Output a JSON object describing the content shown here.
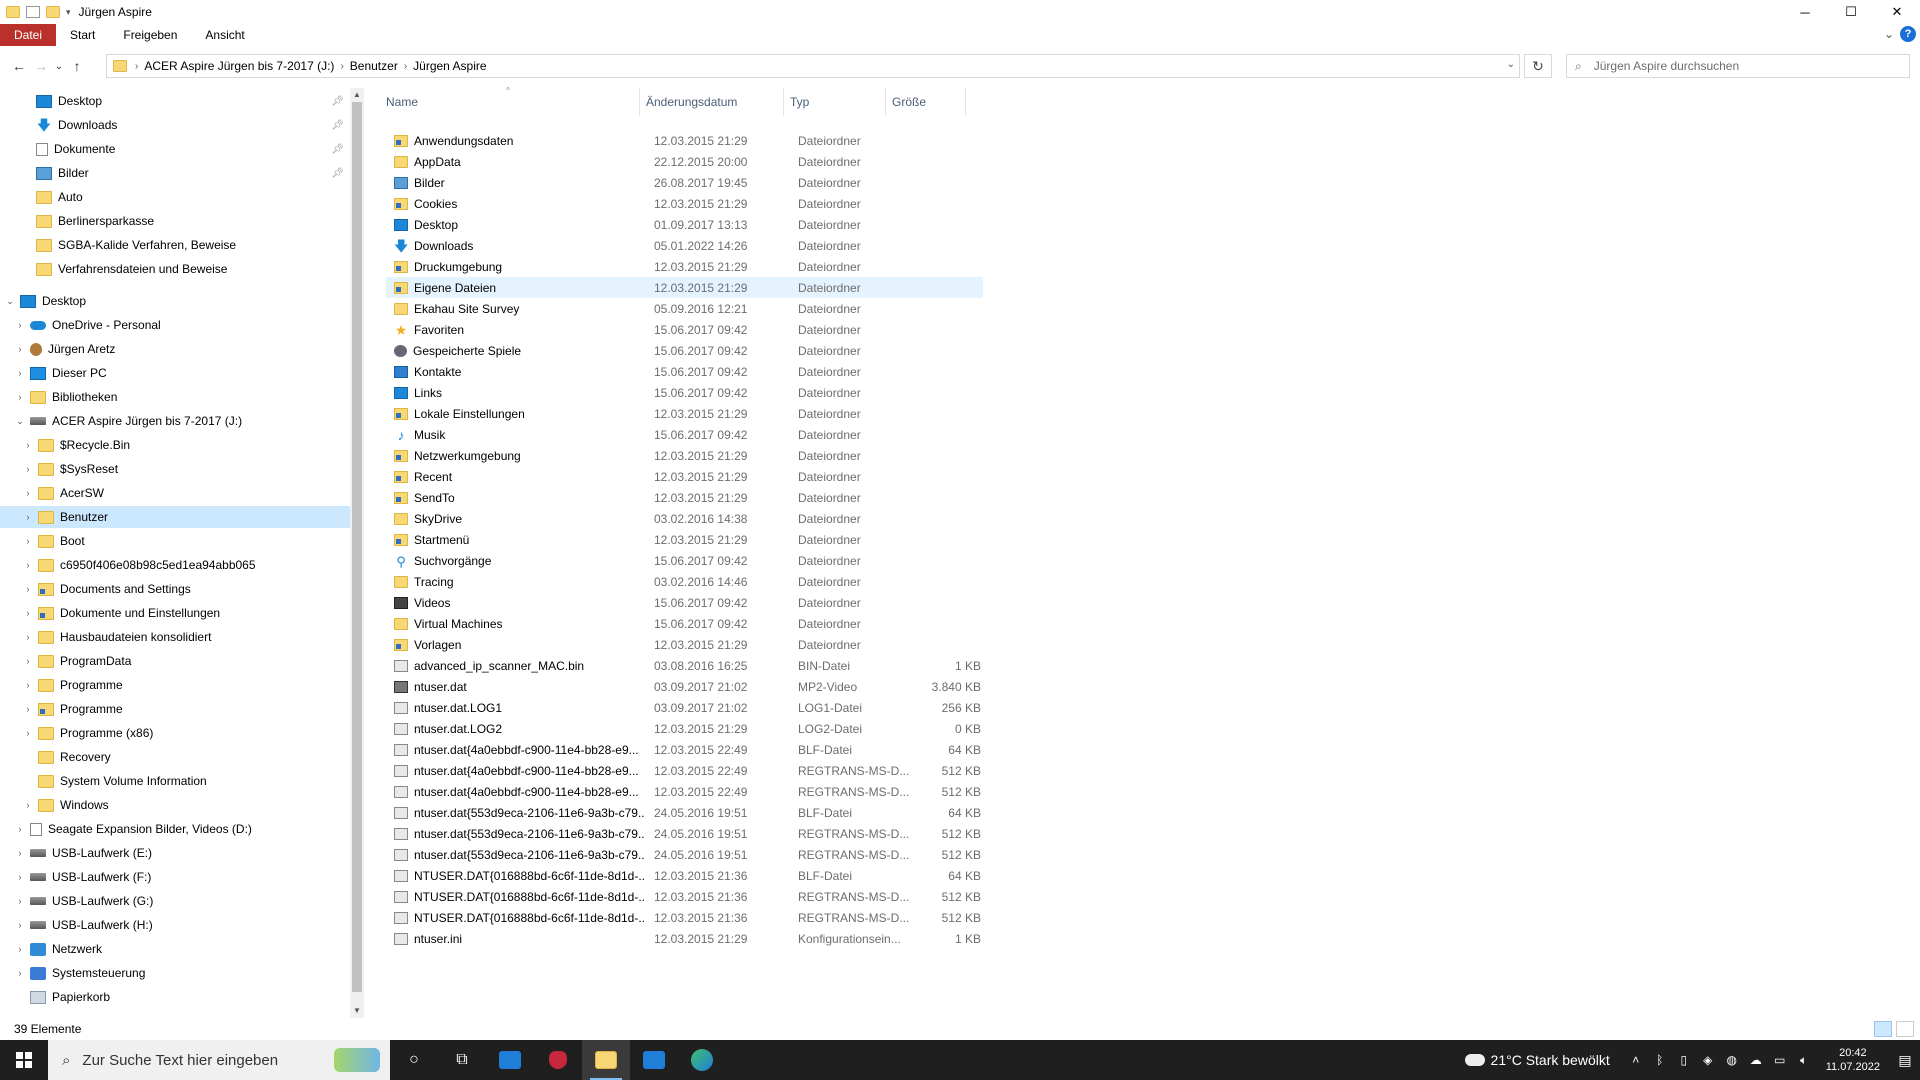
{
  "window": {
    "title": "Jürgen Aspire",
    "controls": {
      "minimize": "─",
      "maximize": "☐",
      "close": "✕"
    }
  },
  "ribbon": {
    "tabs": [
      "Datei",
      "Start",
      "Freigeben",
      "Ansicht"
    ],
    "expand": "⌄",
    "help": "?"
  },
  "nav": {
    "back": "←",
    "forward": "→",
    "recent": "⌄",
    "up": "↑",
    "breadcrumb": [
      "ACER Aspire Jürgen bis 7-2017 (J:)",
      "Benutzer",
      "Jürgen Aspire"
    ],
    "refresh": "↻",
    "search_placeholder": "Jürgen Aspire durchsuchen"
  },
  "tree": {
    "quick_access": [
      {
        "label": "Desktop",
        "icon": "desktop-icon",
        "pinned": true
      },
      {
        "label": "Downloads",
        "icon": "download-icon",
        "pinned": true
      },
      {
        "label": "Dokumente",
        "icon": "document-icon",
        "pinned": true
      },
      {
        "label": "Bilder",
        "icon": "pictures-icon",
        "pinned": true
      },
      {
        "label": "Auto",
        "icon": "folder-icon",
        "pinned": false
      },
      {
        "label": "Berlinersparkasse",
        "icon": "folder-icon",
        "pinned": false
      },
      {
        "label": "SGBA-Kalide Verfahren, Beweise",
        "icon": "folder-icon",
        "pinned": false
      },
      {
        "label": "Verfahrensdateien und Beweise",
        "icon": "folder-icon",
        "pinned": false
      }
    ],
    "desktop_root": "Desktop",
    "desktop_children": [
      {
        "label": "OneDrive - Personal",
        "icon": "onedrive-icon"
      },
      {
        "label": "Jürgen Aretz",
        "icon": "user-icon"
      },
      {
        "label": "Dieser PC",
        "icon": "pc-icon"
      },
      {
        "label": "Bibliotheken",
        "icon": "library-icon"
      },
      {
        "label": "ACER Aspire Jürgen bis 7-2017 (J:)",
        "icon": "drive-icon",
        "expanded": true
      }
    ],
    "drive_children": [
      {
        "label": "$Recycle.Bin",
        "icon": "folder-icon"
      },
      {
        "label": "$SysReset",
        "icon": "folder-icon"
      },
      {
        "label": "AcerSW",
        "icon": "folder-icon"
      },
      {
        "label": "Benutzer",
        "icon": "folder-icon",
        "selected": true
      },
      {
        "label": "Boot",
        "icon": "folder-icon"
      },
      {
        "label": "c6950f406e08b98c5ed1ea94abb065",
        "icon": "folder-icon"
      },
      {
        "label": "Documents and Settings",
        "icon": "link-folder-icon"
      },
      {
        "label": "Dokumente und Einstellungen",
        "icon": "link-folder-icon"
      },
      {
        "label": "Hausbaudateien konsolidiert",
        "icon": "folder-icon"
      },
      {
        "label": "ProgramData",
        "icon": "folder-icon"
      },
      {
        "label": "Programme",
        "icon": "folder-icon"
      },
      {
        "label": "Programme",
        "icon": "link-folder-icon"
      },
      {
        "label": "Programme (x86)",
        "icon": "folder-icon"
      },
      {
        "label": "Recovery",
        "icon": "folder-icon",
        "nochev": true
      },
      {
        "label": "System Volume Information",
        "icon": "folder-icon",
        "nochev": true
      },
      {
        "label": "Windows",
        "icon": "folder-icon"
      }
    ],
    "other_roots": [
      {
        "label": "Seagate Expansion Bilder, Videos (D:)",
        "icon": "doc-drive-icon"
      },
      {
        "label": "USB-Laufwerk (E:)",
        "icon": "drive-icon"
      },
      {
        "label": "USB-Laufwerk (F:)",
        "icon": "drive-icon"
      },
      {
        "label": "USB-Laufwerk (G:)",
        "icon": "drive-icon"
      },
      {
        "label": "USB-Laufwerk (H:)",
        "icon": "drive-icon"
      },
      {
        "label": "Netzwerk",
        "icon": "network-icon"
      },
      {
        "label": "Systemsteuerung",
        "icon": "control-panel-icon"
      },
      {
        "label": "Papierkorb",
        "icon": "recycle-bin-icon",
        "nochev": true
      }
    ]
  },
  "columns": [
    "Name",
    "Änderungsdatum",
    "Typ",
    "Größe"
  ],
  "files": [
    {
      "name": "Anwendungsdaten",
      "date": "12.03.2015 21:29",
      "type": "Dateiordner",
      "size": "",
      "icon": "link-folder-icon"
    },
    {
      "name": "AppData",
      "date": "22.12.2015 20:00",
      "type": "Dateiordner",
      "size": "",
      "icon": "folder-icon"
    },
    {
      "name": "Bilder",
      "date": "26.08.2017 19:45",
      "type": "Dateiordner",
      "size": "",
      "icon": "pictures-icon"
    },
    {
      "name": "Cookies",
      "date": "12.03.2015 21:29",
      "type": "Dateiordner",
      "size": "",
      "icon": "link-folder-icon"
    },
    {
      "name": "Desktop",
      "date": "01.09.2017 13:13",
      "type": "Dateiordner",
      "size": "",
      "icon": "desktop-icon"
    },
    {
      "name": "Downloads",
      "date": "05.01.2022 14:26",
      "type": "Dateiordner",
      "size": "",
      "icon": "download-icon"
    },
    {
      "name": "Druckumgebung",
      "date": "12.03.2015 21:29",
      "type": "Dateiordner",
      "size": "",
      "icon": "link-folder-icon"
    },
    {
      "name": "Eigene Dateien",
      "date": "12.03.2015 21:29",
      "type": "Dateiordner",
      "size": "",
      "icon": "link-folder-icon",
      "selected": true
    },
    {
      "name": "Ekahau Site Survey",
      "date": "05.09.2016 12:21",
      "type": "Dateiordner",
      "size": "",
      "icon": "folder-icon"
    },
    {
      "name": "Favoriten",
      "date": "15.06.2017 09:42",
      "type": "Dateiordner",
      "size": "",
      "icon": "star-icon"
    },
    {
      "name": "Gespeicherte Spiele",
      "date": "15.06.2017 09:42",
      "type": "Dateiordner",
      "size": "",
      "icon": "games-icon"
    },
    {
      "name": "Kontakte",
      "date": "15.06.2017 09:42",
      "type": "Dateiordner",
      "size": "",
      "icon": "contacts-icon"
    },
    {
      "name": "Links",
      "date": "15.06.2017 09:42",
      "type": "Dateiordner",
      "size": "",
      "icon": "links-icon"
    },
    {
      "name": "Lokale Einstellungen",
      "date": "12.03.2015 21:29",
      "type": "Dateiordner",
      "size": "",
      "icon": "link-folder-icon"
    },
    {
      "name": "Musik",
      "date": "15.06.2017 09:42",
      "type": "Dateiordner",
      "size": "",
      "icon": "music-icon"
    },
    {
      "name": "Netzwerkumgebung",
      "date": "12.03.2015 21:29",
      "type": "Dateiordner",
      "size": "",
      "icon": "link-folder-icon"
    },
    {
      "name": "Recent",
      "date": "12.03.2015 21:29",
      "type": "Dateiordner",
      "size": "",
      "icon": "link-folder-icon"
    },
    {
      "name": "SendTo",
      "date": "12.03.2015 21:29",
      "type": "Dateiordner",
      "size": "",
      "icon": "link-folder-icon"
    },
    {
      "name": "SkyDrive",
      "date": "03.02.2016 14:38",
      "type": "Dateiordner",
      "size": "",
      "icon": "folder-icon"
    },
    {
      "name": "Startmenü",
      "date": "12.03.2015 21:29",
      "type": "Dateiordner",
      "size": "",
      "icon": "link-folder-icon"
    },
    {
      "name": "Suchvorgänge",
      "date": "15.06.2017 09:42",
      "type": "Dateiordner",
      "size": "",
      "icon": "search-folder-icon"
    },
    {
      "name": "Tracing",
      "date": "03.02.2016 14:46",
      "type": "Dateiordner",
      "size": "",
      "icon": "folder-icon"
    },
    {
      "name": "Videos",
      "date": "15.06.2017 09:42",
      "type": "Dateiordner",
      "size": "",
      "icon": "videos-icon"
    },
    {
      "name": "Virtual Machines",
      "date": "15.06.2017 09:42",
      "type": "Dateiordner",
      "size": "",
      "icon": "folder-icon"
    },
    {
      "name": "Vorlagen",
      "date": "12.03.2015 21:29",
      "type": "Dateiordner",
      "size": "",
      "icon": "link-folder-icon"
    },
    {
      "name": "advanced_ip_scanner_MAC.bin",
      "date": "03.08.2016 16:25",
      "type": "BIN-Datei",
      "size": "1 KB",
      "icon": "file-icon"
    },
    {
      "name": "ntuser.dat",
      "date": "03.09.2017 21:02",
      "type": "MP2-Video",
      "size": "3.840 KB",
      "icon": "media-file-icon"
    },
    {
      "name": "ntuser.dat.LOG1",
      "date": "03.09.2017 21:02",
      "type": "LOG1-Datei",
      "size": "256 KB",
      "icon": "file-icon"
    },
    {
      "name": "ntuser.dat.LOG2",
      "date": "12.03.2015 21:29",
      "type": "LOG2-Datei",
      "size": "0 KB",
      "icon": "file-icon"
    },
    {
      "name": "ntuser.dat{4a0ebbdf-c900-11e4-bb28-e9...",
      "date": "12.03.2015 22:49",
      "type": "BLF-Datei",
      "size": "64 KB",
      "icon": "file-icon"
    },
    {
      "name": "ntuser.dat{4a0ebbdf-c900-11e4-bb28-e9...",
      "date": "12.03.2015 22:49",
      "type": "REGTRANS-MS-D...",
      "size": "512 KB",
      "icon": "file-icon"
    },
    {
      "name": "ntuser.dat{4a0ebbdf-c900-11e4-bb28-e9...",
      "date": "12.03.2015 22:49",
      "type": "REGTRANS-MS-D...",
      "size": "512 KB",
      "icon": "file-icon"
    },
    {
      "name": "ntuser.dat{553d9eca-2106-11e6-9a3b-c79...",
      "date": "24.05.2016 19:51",
      "type": "BLF-Datei",
      "size": "64 KB",
      "icon": "file-icon"
    },
    {
      "name": "ntuser.dat{553d9eca-2106-11e6-9a3b-c79...",
      "date": "24.05.2016 19:51",
      "type": "REGTRANS-MS-D...",
      "size": "512 KB",
      "icon": "file-icon"
    },
    {
      "name": "ntuser.dat{553d9eca-2106-11e6-9a3b-c79...",
      "date": "24.05.2016 19:51",
      "type": "REGTRANS-MS-D...",
      "size": "512 KB",
      "icon": "file-icon"
    },
    {
      "name": "NTUSER.DAT{016888bd-6c6f-11de-8d1d-...",
      "date": "12.03.2015 21:36",
      "type": "BLF-Datei",
      "size": "64 KB",
      "icon": "file-icon"
    },
    {
      "name": "NTUSER.DAT{016888bd-6c6f-11de-8d1d-...",
      "date": "12.03.2015 21:36",
      "type": "REGTRANS-MS-D...",
      "size": "512 KB",
      "icon": "file-icon"
    },
    {
      "name": "NTUSER.DAT{016888bd-6c6f-11de-8d1d-...",
      "date": "12.03.2015 21:36",
      "type": "REGTRANS-MS-D...",
      "size": "512 KB",
      "icon": "file-icon"
    },
    {
      "name": "ntuser.ini",
      "date": "12.03.2015 21:29",
      "type": "Konfigurationsein...",
      "size": "1 KB",
      "icon": "ini-file-icon"
    }
  ],
  "status": {
    "count": "39 Elemente"
  },
  "taskbar": {
    "search_placeholder": "Zur Suche Text hier eingeben",
    "weather": "21°C  Stark bewölkt",
    "time": "20:42",
    "date": "11.07.2022"
  }
}
